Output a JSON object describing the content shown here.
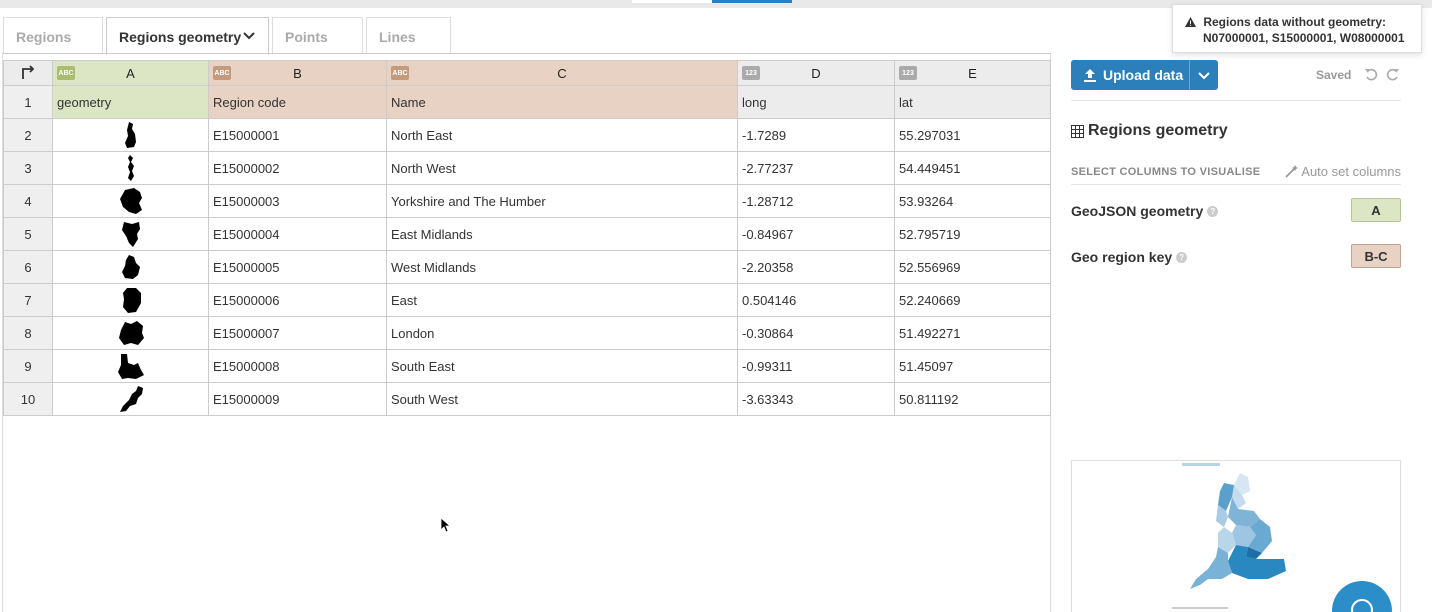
{
  "tabs": [
    {
      "label": "Regions",
      "active": false
    },
    {
      "label": "Regions geometry",
      "active": true
    },
    {
      "label": "Points",
      "active": false
    },
    {
      "label": "Lines",
      "active": false
    }
  ],
  "columns": [
    {
      "letter": "A",
      "type_badge": "ABC",
      "header": "geometry"
    },
    {
      "letter": "B",
      "type_badge": "ABC",
      "header": "Region code"
    },
    {
      "letter": "C",
      "type_badge": "ABC",
      "header": "Name"
    },
    {
      "letter": "D",
      "type_badge": "123",
      "header": "long"
    },
    {
      "letter": "E",
      "type_badge": "123",
      "header": "lat"
    }
  ],
  "header_row_number": "1",
  "rows": [
    {
      "num": "2",
      "code": "E15000001",
      "name": "North East",
      "long": "-1.7289",
      "lat": "55.297031"
    },
    {
      "num": "3",
      "code": "E15000002",
      "name": "North West",
      "long": "-2.77237",
      "lat": "54.449451"
    },
    {
      "num": "4",
      "code": "E15000003",
      "name": "Yorkshire and The Humber",
      "long": "-1.28712",
      "lat": "53.93264"
    },
    {
      "num": "5",
      "code": "E15000004",
      "name": "East Midlands",
      "long": "-0.84967",
      "lat": "52.795719"
    },
    {
      "num": "6",
      "code": "E15000005",
      "name": "West Midlands",
      "long": "-2.20358",
      "lat": "52.556969"
    },
    {
      "num": "7",
      "code": "E15000006",
      "name": "East",
      "long": "0.504146",
      "lat": "52.240669"
    },
    {
      "num": "8",
      "code": "E15000007",
      "name": "London",
      "long": "-0.30864",
      "lat": "51.492271"
    },
    {
      "num": "9",
      "code": "E15000008",
      "name": "South East",
      "long": "-0.99311",
      "lat": "51.45097"
    },
    {
      "num": "10",
      "code": "E15000009",
      "name": "South West",
      "long": "-3.63343",
      "lat": "50.811192"
    }
  ],
  "panel": {
    "upload_label": "Upload data",
    "saved_label": "Saved",
    "section_title": "Regions geometry",
    "select_columns_label": "SELECT COLUMNS TO VISUALISE",
    "auto_set_label": "Auto set columns",
    "geojson_label": "GeoJSON geometry",
    "geojson_value": "A",
    "region_key_label": "Geo region key",
    "region_key_value": "B-C"
  },
  "toast": {
    "line1": "Regions data without geometry:",
    "line2": "N07000001, S15000001, W08000001"
  },
  "colors": {
    "accent": "#2b80bb",
    "geometry_column": "#dce6c5",
    "key_columns": "#e7d2c4"
  },
  "icons": [
    "corner-arrow-icon",
    "chevron-down-icon",
    "upload-icon",
    "undo-icon",
    "redo-icon",
    "table-icon",
    "magic-wand-icon",
    "help-icon",
    "warning-icon"
  ]
}
